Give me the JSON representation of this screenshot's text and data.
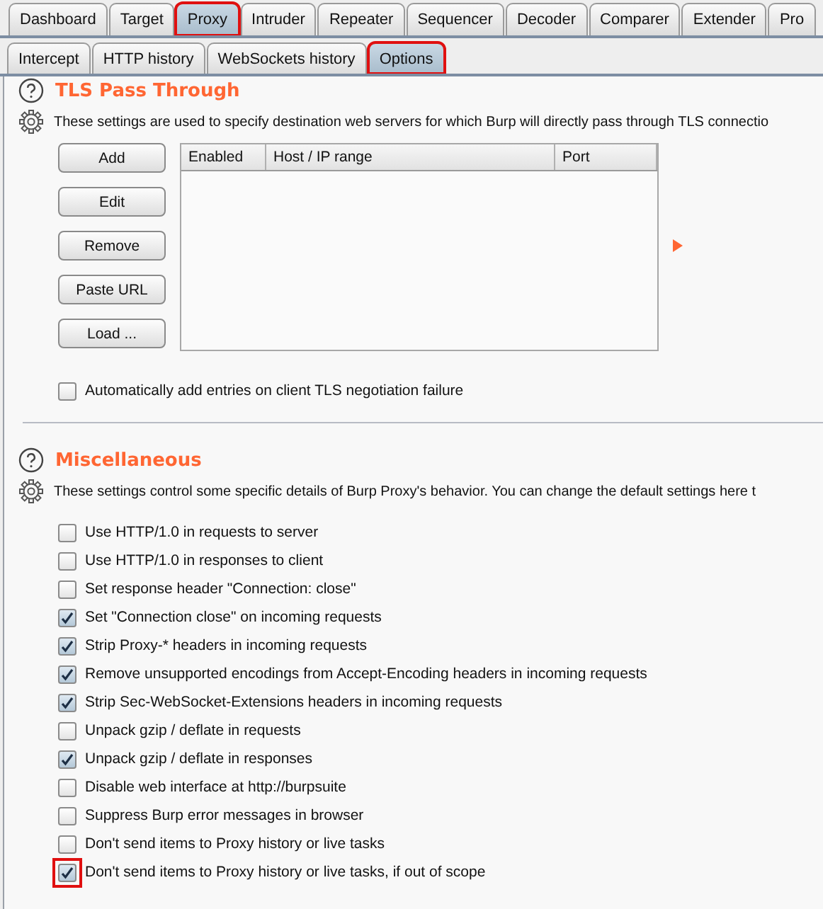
{
  "top_tabs": [
    {
      "label": "Dashboard",
      "selected": false,
      "highlighted": false
    },
    {
      "label": "Target",
      "selected": false,
      "highlighted": false
    },
    {
      "label": "Proxy",
      "selected": true,
      "highlighted": true
    },
    {
      "label": "Intruder",
      "selected": false,
      "highlighted": false
    },
    {
      "label": "Repeater",
      "selected": false,
      "highlighted": false
    },
    {
      "label": "Sequencer",
      "selected": false,
      "highlighted": false
    },
    {
      "label": "Decoder",
      "selected": false,
      "highlighted": false
    },
    {
      "label": "Comparer",
      "selected": false,
      "highlighted": false
    },
    {
      "label": "Extender",
      "selected": false,
      "highlighted": false
    },
    {
      "label": "Pro",
      "selected": false,
      "highlighted": false
    }
  ],
  "sub_tabs": [
    {
      "label": "Intercept",
      "selected": false,
      "highlighted": false
    },
    {
      "label": "HTTP history",
      "selected": false,
      "highlighted": false
    },
    {
      "label": "WebSockets history",
      "selected": false,
      "highlighted": false
    },
    {
      "label": "Options",
      "selected": true,
      "highlighted": true
    }
  ],
  "tls_pass_through": {
    "title": "TLS Pass Through",
    "description": "These settings are used to specify destination web servers for which Burp will directly pass through TLS connectio",
    "buttons": [
      "Add",
      "Edit",
      "Remove",
      "Paste URL",
      "Load ..."
    ],
    "table": {
      "columns": [
        "Enabled",
        "Host / IP range",
        "Port"
      ]
    },
    "auto_add": {
      "label": "Automatically add entries on client TLS negotiation failure",
      "checked": false,
      "highlighted": false
    }
  },
  "miscellaneous": {
    "title": "Miscellaneous",
    "description": "These settings control some specific details of Burp Proxy's behavior. You can change the default settings here t",
    "options": [
      {
        "label": "Use HTTP/1.0 in requests to server",
        "checked": false,
        "highlighted": false
      },
      {
        "label": "Use HTTP/1.0 in responses to client",
        "checked": false,
        "highlighted": false
      },
      {
        "label": "Set response header \"Connection: close\"",
        "checked": false,
        "highlighted": false
      },
      {
        "label": "Set \"Connection close\" on incoming requests",
        "checked": true,
        "highlighted": false
      },
      {
        "label": "Strip Proxy-* headers in incoming requests",
        "checked": true,
        "highlighted": false
      },
      {
        "label": "Remove unsupported encodings from Accept-Encoding headers in incoming requests",
        "checked": true,
        "highlighted": false
      },
      {
        "label": "Strip Sec-WebSocket-Extensions headers in incoming requests",
        "checked": true,
        "highlighted": false
      },
      {
        "label": "Unpack gzip / deflate in requests",
        "checked": false,
        "highlighted": false
      },
      {
        "label": "Unpack gzip / deflate in responses",
        "checked": true,
        "highlighted": false
      },
      {
        "label": "Disable web interface at http://burpsuite",
        "checked": false,
        "highlighted": false
      },
      {
        "label": "Suppress Burp error messages in browser",
        "checked": false,
        "highlighted": false
      },
      {
        "label": "Don't send items to Proxy history or live tasks",
        "checked": false,
        "highlighted": false
      },
      {
        "label": "Don't send items to Proxy history or live tasks, if out of scope",
        "checked": true,
        "highlighted": true
      }
    ]
  }
}
